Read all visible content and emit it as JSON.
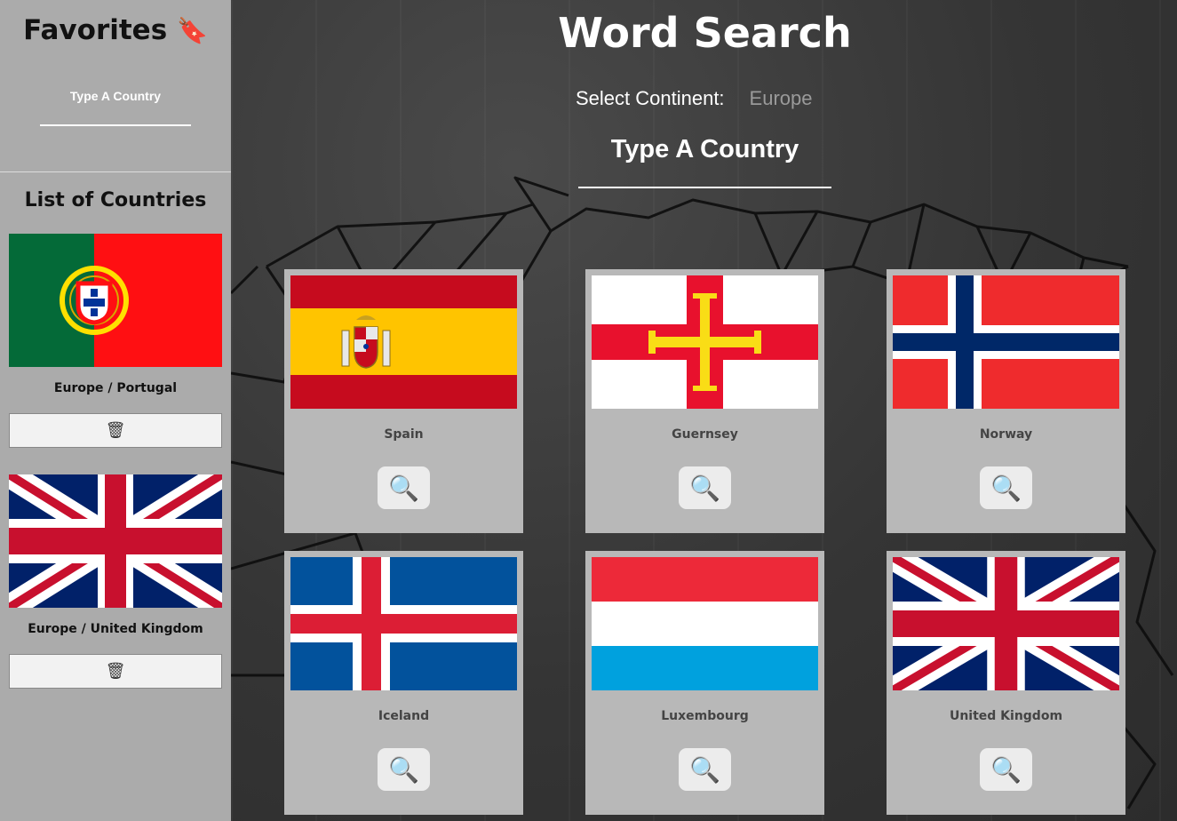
{
  "sidebar": {
    "favorites_title": "Favorites",
    "favorites_icon": "bookmark-icon",
    "favorites_placeholder": "Type A Country",
    "list_title": "List of Countries",
    "items": [
      {
        "caption": "Europe / Portugal",
        "flag": "portugal-flag",
        "remove_icon": "trash-icon",
        "remove_glyph": "🗑"
      },
      {
        "caption": "Europe / United Kingdom",
        "flag": "united-kingdom-flag",
        "remove_icon": "trash-icon",
        "remove_glyph": "🗑"
      }
    ]
  },
  "main": {
    "title": "Word Search",
    "continent_label": "Select Continent:",
    "continent_value": "Europe",
    "search_placeholder": "Type A Country",
    "cards": [
      {
        "name": "Spain",
        "flag": "spain-flag",
        "button_icon": "magnifier-icon",
        "button_glyph": "🔍"
      },
      {
        "name": "Guernsey",
        "flag": "guernsey-flag",
        "button_icon": "magnifier-icon",
        "button_glyph": "🔍"
      },
      {
        "name": "Norway",
        "flag": "norway-flag",
        "button_icon": "magnifier-icon",
        "button_glyph": "🔍"
      },
      {
        "name": "Iceland",
        "flag": "iceland-flag",
        "button_icon": "magnifier-icon",
        "button_glyph": "🔍"
      },
      {
        "name": "Luxembourg",
        "flag": "luxembourg-flag",
        "button_icon": "magnifier-icon",
        "button_glyph": "🔍"
      },
      {
        "name": "United Kingdom",
        "flag": "united-kingdom-flag",
        "button_icon": "magnifier-icon",
        "button_glyph": "🔍"
      }
    ]
  },
  "colors": {
    "sidebar_bg": "#ababab",
    "card_bg": "#b8b8b8",
    "spain_red": "#c60b1e",
    "spain_yellow": "#ffc400",
    "portugal_green": "#046a38",
    "portugal_red": "#ff0f12",
    "uk_blue": "#012169",
    "uk_red": "#c8102e",
    "norway_red": "#ef2b2d",
    "norway_blue": "#002868",
    "iceland_blue": "#02529c",
    "iceland_red": "#dc1e35",
    "luxembourg_red": "#ed2939",
    "luxembourg_blue": "#00a1de",
    "guernsey_red": "#e8112d",
    "guernsey_gold": "#f9dd16"
  }
}
